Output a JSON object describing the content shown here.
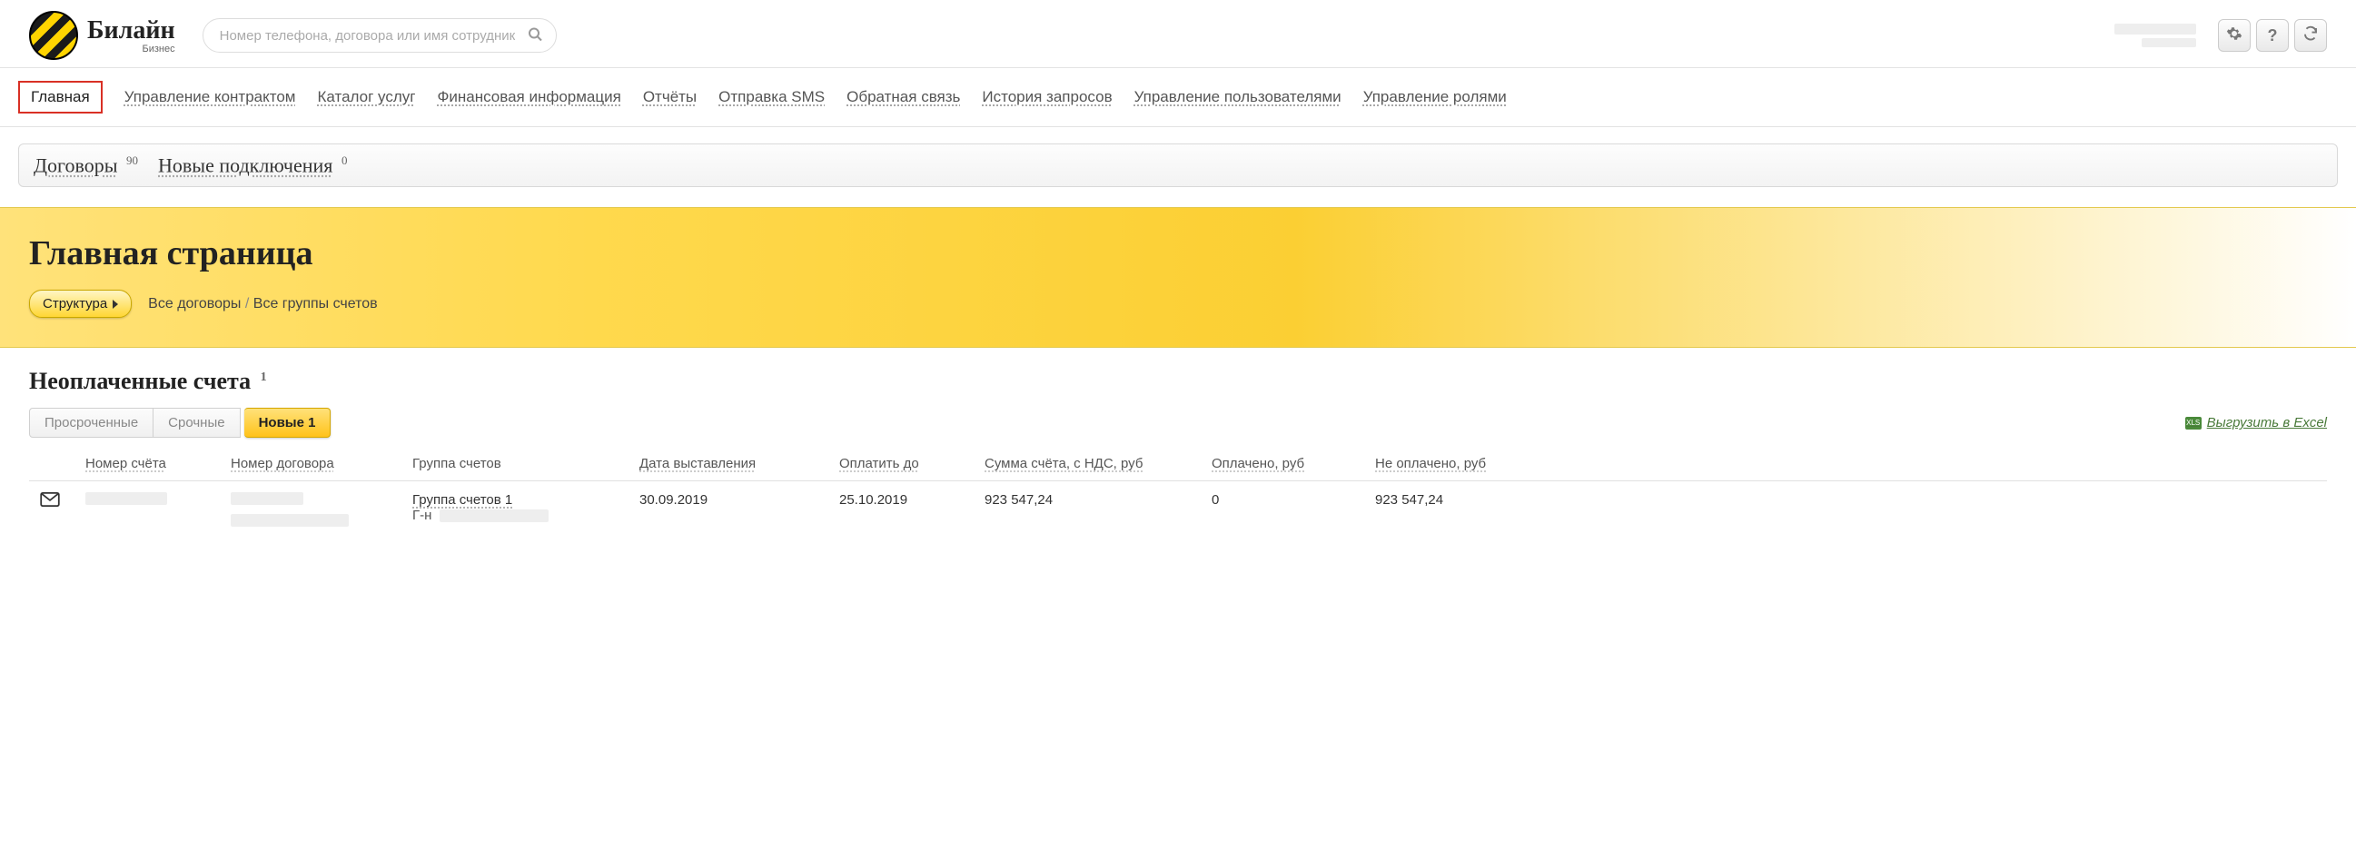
{
  "header": {
    "logo_text": "Билайн",
    "logo_sub": "Бизнес",
    "search_placeholder": "Номер телефона, договора или имя сотрудника"
  },
  "nav": {
    "items": [
      "Главная",
      "Управление контрактом",
      "Каталог услуг",
      "Финансовая информация",
      "Отчёты",
      "Отправка SMS",
      "Обратная связь",
      "История запросов",
      "Управление пользователями",
      "Управление ролями"
    ],
    "active_index": 0
  },
  "subtabs": {
    "contracts_label": "Договоры",
    "contracts_count": "90",
    "new_conn_label": "Новые подключения",
    "new_conn_count": "0"
  },
  "banner": {
    "title": "Главная страница",
    "structure_btn": "Структура",
    "breadcrumb": [
      "Все договоры",
      "Все группы счетов"
    ]
  },
  "section": {
    "title": "Неоплаченные счета",
    "count": "1",
    "tabs": {
      "overdue": "Просроченные",
      "urgent": "Срочные",
      "new": "Новые 1"
    },
    "export_label": "Выгрузить в Excel"
  },
  "table": {
    "headers": {
      "icon": "",
      "invoice_no": "Номер счёта",
      "contract_no": "Номер договора",
      "group": "Группа счетов",
      "issue_date": "Дата выставления",
      "pay_by": "Оплатить до",
      "amount": "Сумма счёта, с НДС, руб",
      "paid": "Оплачено, руб",
      "unpaid": "Не оплачено, руб"
    },
    "rows": [
      {
        "group_link": "Группа счетов 1",
        "group_sub_prefix": "Г-н",
        "issue_date": "30.09.2019",
        "pay_by": "25.10.2019",
        "amount": "923 547,24",
        "paid": "0",
        "unpaid": "923 547,24"
      }
    ]
  }
}
